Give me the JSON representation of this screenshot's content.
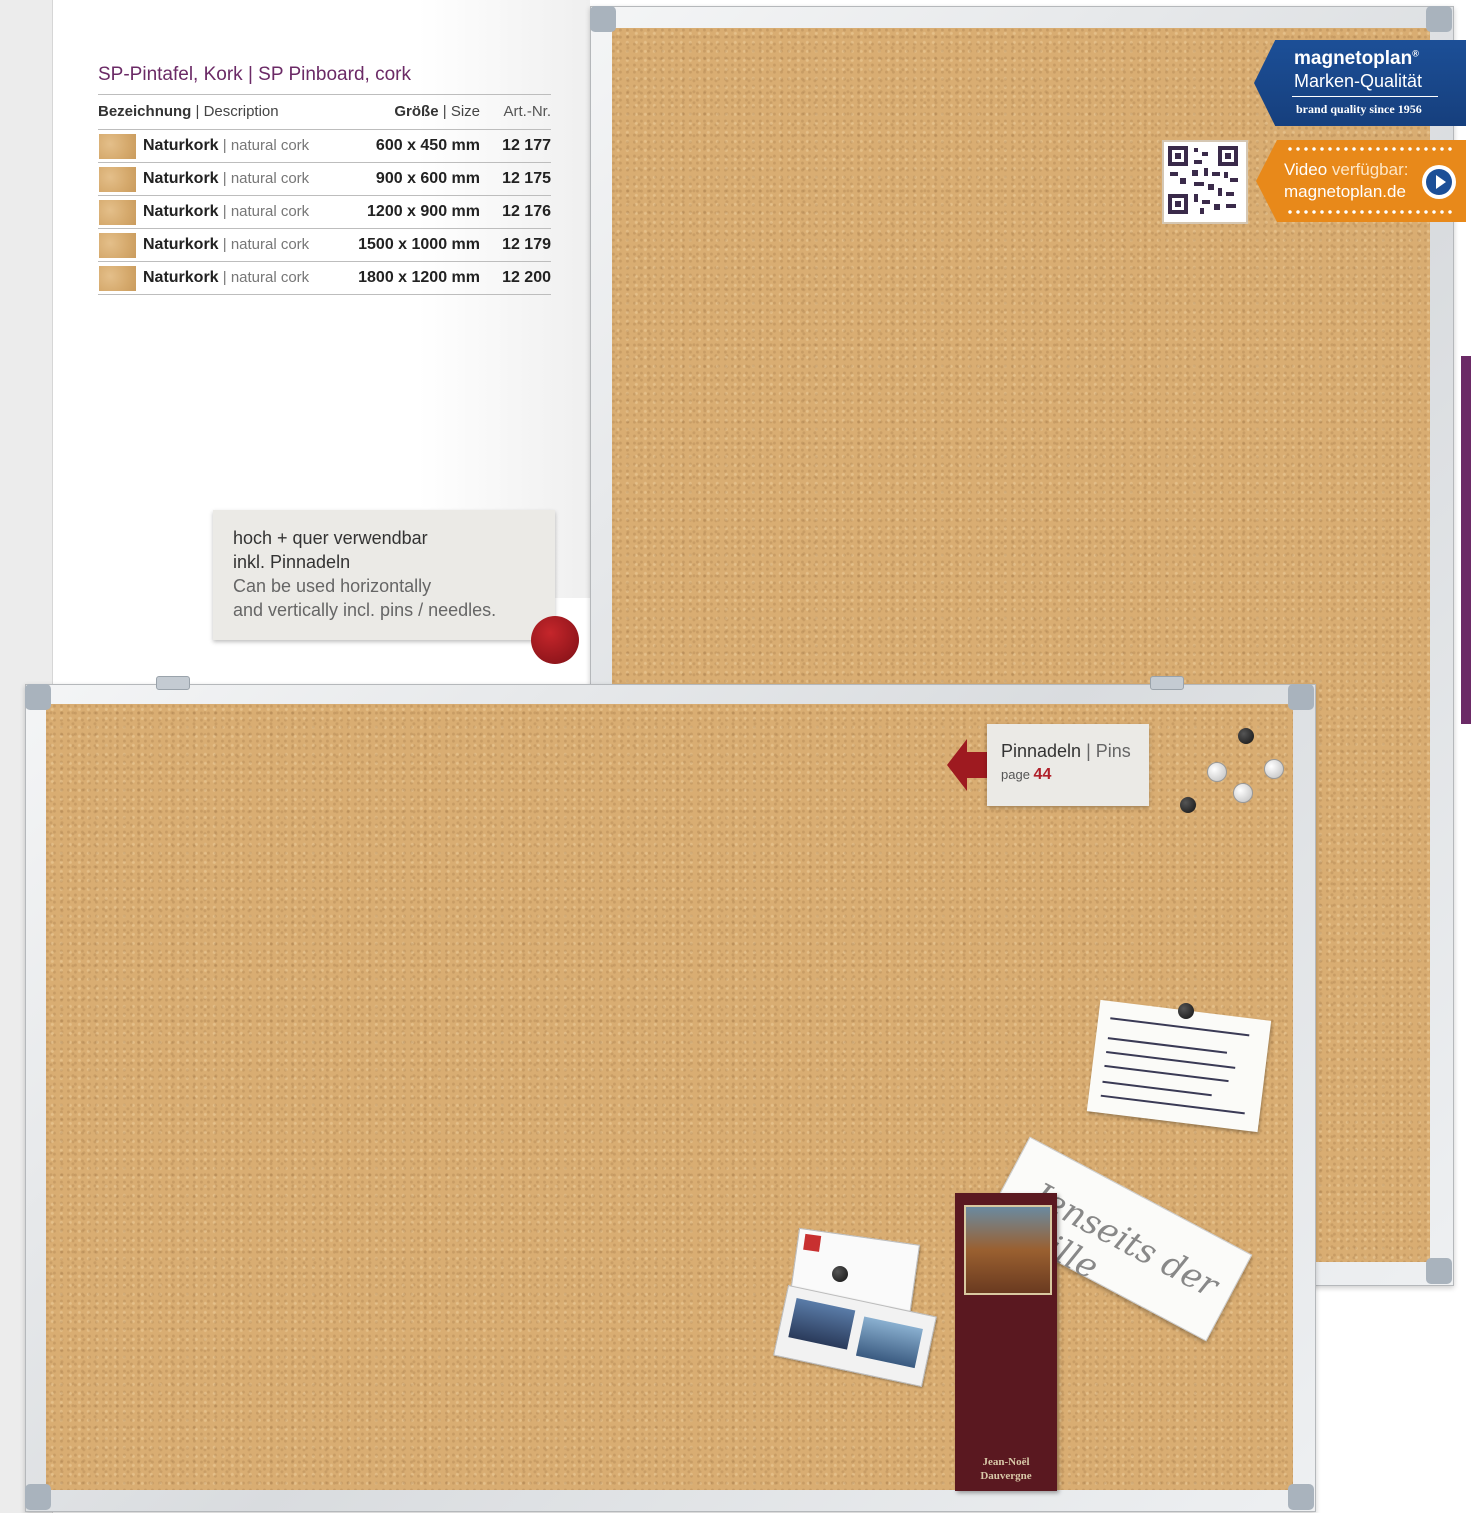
{
  "product": {
    "title_de": "SP-Pintafel, Kork",
    "title_sep": " | ",
    "title_en": "SP Pinboard, cork",
    "header": {
      "desc_de": "Bezeichnung",
      "desc_sep": " | ",
      "desc_en": "Description",
      "size_de": "Größe",
      "size_sep": " | ",
      "size_en": "Size",
      "art": "Art.-Nr."
    },
    "rows": [
      {
        "name_de": "Naturkork",
        "sep": " | ",
        "name_en": "natural cork",
        "size": "600 x 450 mm",
        "art": "12 177"
      },
      {
        "name_de": "Naturkork",
        "sep": " | ",
        "name_en": "natural cork",
        "size": "900 x 600 mm",
        "art": "12 175"
      },
      {
        "name_de": "Naturkork",
        "sep": " | ",
        "name_en": "natural cork",
        "size": "1200 x 900 mm",
        "art": "12 176"
      },
      {
        "name_de": "Naturkork",
        "sep": " | ",
        "name_en": "natural cork",
        "size": "1500 x 1000 mm",
        "art": "12 179"
      },
      {
        "name_de": "Naturkork",
        "sep": " | ",
        "name_en": "natural cork",
        "size": "1800 x 1200 mm",
        "art": "12 200"
      }
    ]
  },
  "note": {
    "line1": "hoch + quer verwendbar",
    "line2": "inkl. Pinnadeln",
    "line3": "Can be used horizontally",
    "line4": "and vertically incl. pins / needles."
  },
  "brand": {
    "name": "magnetoplan",
    "reg": "®",
    "quality": "Marken-Qualität",
    "since": "brand quality since 1956",
    "color": "#1c4f97"
  },
  "video": {
    "label_bold": "Video",
    "label_light": " verfügbar:",
    "site": "magnetoplan.de",
    "color": "#e8891a"
  },
  "pins": {
    "label_de": "Pinnadeln",
    "sep": " | ",
    "label_en": "Pins",
    "page_label": "page",
    "page_number": "44"
  },
  "bookmark": {
    "name_line1": "Jean-Noël",
    "name_line2": "Dauvergne"
  },
  "card_script": "Jenseits der Stille",
  "accent_color": "#6b2a66"
}
